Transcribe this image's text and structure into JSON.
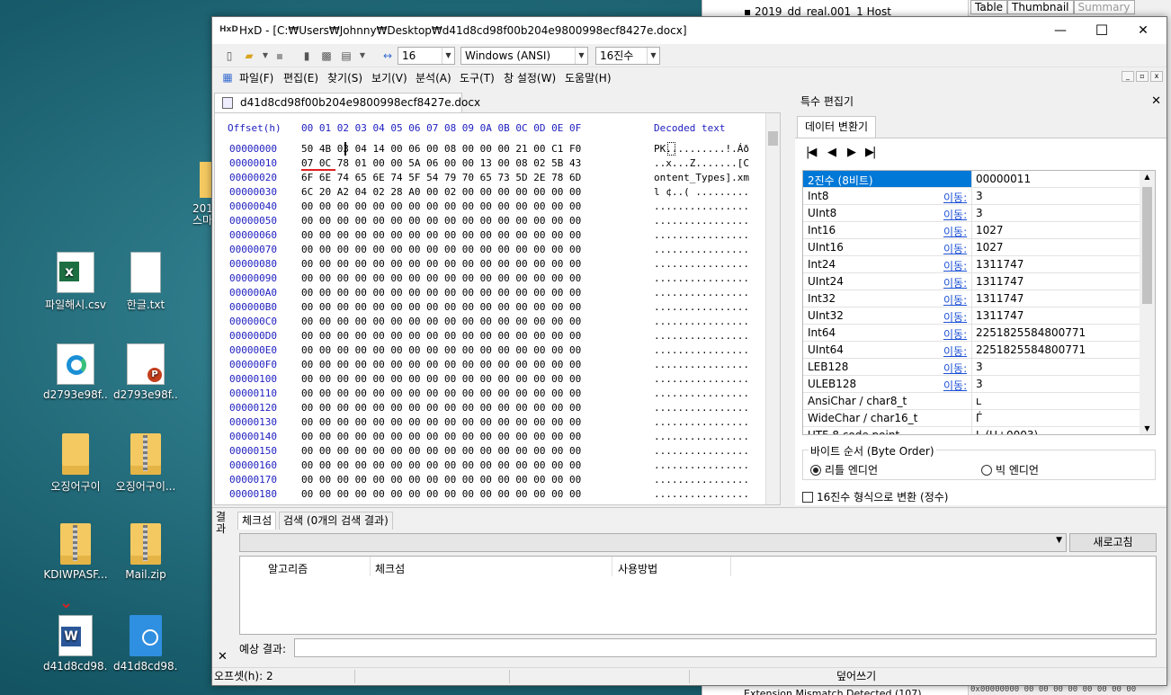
{
  "background_window": {
    "tree_item_top": "2019_dd_real.001_1 Host",
    "tree_item_bottom": "Extension Mismatch Detected (107)",
    "tabs": [
      "Table",
      "Thumbnail",
      "Summary"
    ],
    "bottom_hex": "0x00000000  00 00 00 00  00 00 00 00"
  },
  "desktop": {
    "icons": [
      {
        "label": "파일해시.csv"
      },
      {
        "label": "한글.txt"
      },
      {
        "label": "d2793e98f..."
      },
      {
        "label": "d2793e98f..."
      },
      {
        "label": "오징어구이"
      },
      {
        "label": "오징어구이..."
      },
      {
        "label": "KDIWPASF..."
      },
      {
        "label": "Mail.zip"
      },
      {
        "label": "d41d8cd98..."
      },
      {
        "label": "d41d8cd98..."
      }
    ],
    "partial_label": "201\n스마"
  },
  "window": {
    "title": "HxD - [C:₩Users₩Johnny₩Desktop₩d41d8cd98f00b204e9800998ecf8427e.docx]",
    "controls": {
      "minimize": "—",
      "maximize": "☐",
      "close": "✕"
    }
  },
  "toolbar": {
    "bytes_per_row": "16",
    "charset": "Windows (ANSI)",
    "offset_base": "16진수"
  },
  "menu": [
    "파일(F)",
    "편집(E)",
    "찾기(S)",
    "보기(V)",
    "분석(A)",
    "도구(T)",
    "창 설정(W)",
    "도움말(H)"
  ],
  "doc_tab": "d41d8cd98f00b204e9800998ecf8427e.docx",
  "hex_view": {
    "header_offset": "Offset(h)",
    "header_cols": "00 01 02 03 04 05 06 07 08 09 0A 0B 0C 0D 0E 0F",
    "header_decoded": "Decoded text",
    "offsets": [
      "00000000",
      "00000010",
      "00000020",
      "00000030",
      "00000040",
      "00000050",
      "00000060",
      "00000070",
      "00000080",
      "00000090",
      "000000A0",
      "000000B0",
      "000000C0",
      "000000D0",
      "000000E0",
      "000000F0",
      "00000100",
      "00000110",
      "00000120",
      "00000130",
      "00000140",
      "00000150",
      "00000160",
      "00000170",
      "00000180"
    ],
    "rows": [
      "50 4B 03 04 14 00 06 00 08 00 00 00 21 00 C1 F0",
      "07 0C 78 01 00 00 5A 06 00 00 13 00 08 02 5B 43",
      "6F 6E 74 65 6E 74 5F 54 79 70 65 73 5D 2E 78 6D",
      "6C 20 A2 04 02 28 A0 00 02 00 00 00 00 00 00 00",
      "00 00 00 00 00 00 00 00 00 00 00 00 00 00 00 00",
      "00 00 00 00 00 00 00 00 00 00 00 00 00 00 00 00",
      "00 00 00 00 00 00 00 00 00 00 00 00 00 00 00 00",
      "00 00 00 00 00 00 00 00 00 00 00 00 00 00 00 00",
      "00 00 00 00 00 00 00 00 00 00 00 00 00 00 00 00",
      "00 00 00 00 00 00 00 00 00 00 00 00 00 00 00 00",
      "00 00 00 00 00 00 00 00 00 00 00 00 00 00 00 00",
      "00 00 00 00 00 00 00 00 00 00 00 00 00 00 00 00",
      "00 00 00 00 00 00 00 00 00 00 00 00 00 00 00 00",
      "00 00 00 00 00 00 00 00 00 00 00 00 00 00 00 00",
      "00 00 00 00 00 00 00 00 00 00 00 00 00 00 00 00",
      "00 00 00 00 00 00 00 00 00 00 00 00 00 00 00 00",
      "00 00 00 00 00 00 00 00 00 00 00 00 00 00 00 00",
      "00 00 00 00 00 00 00 00 00 00 00 00 00 00 00 00",
      "00 00 00 00 00 00 00 00 00 00 00 00 00 00 00 00",
      "00 00 00 00 00 00 00 00 00 00 00 00 00 00 00 00",
      "00 00 00 00 00 00 00 00 00 00 00 00 00 00 00 00",
      "00 00 00 00 00 00 00 00 00 00 00 00 00 00 00 00",
      "00 00 00 00 00 00 00 00 00 00 00 00 00 00 00 00",
      "00 00 00 00 00 00 00 00 00 00 00 00 00 00 00 00",
      "00 00 00 00 00 00 00 00 00 00 00 00 00 00 00 00"
    ],
    "decoded": [
      "PK..........!.Áð",
      "..x...Z.......[C",
      "ontent_Types].xm",
      "l ¢..( .........",
      "................",
      "................",
      "................",
      "................",
      "................",
      "................",
      "................",
      "................",
      "................",
      "................",
      "................",
      "................",
      "................",
      "................",
      "................",
      "................",
      "................",
      "................",
      "................",
      "................",
      "................"
    ]
  },
  "special_editor": {
    "title": "특수 편집기",
    "tab": "데이터 변환기",
    "rows": [
      {
        "name": "2진수 (8비트)",
        "go": "",
        "value": "00000011"
      },
      {
        "name": "Int8",
        "go": "이동:",
        "value": "3"
      },
      {
        "name": "UInt8",
        "go": "이동:",
        "value": "3"
      },
      {
        "name": "Int16",
        "go": "이동:",
        "value": "1027"
      },
      {
        "name": "UInt16",
        "go": "이동:",
        "value": "1027"
      },
      {
        "name": "Int24",
        "go": "이동:",
        "value": "1311747"
      },
      {
        "name": "UInt24",
        "go": "이동:",
        "value": "1311747"
      },
      {
        "name": "Int32",
        "go": "이동:",
        "value": "1311747"
      },
      {
        "name": "UInt32",
        "go": "이동:",
        "value": "1311747"
      },
      {
        "name": "Int64",
        "go": "이동:",
        "value": "2251825584800771"
      },
      {
        "name": "UInt64",
        "go": "이동:",
        "value": "2251825584800771"
      },
      {
        "name": "LEB128",
        "go": "이동:",
        "value": "3"
      },
      {
        "name": "ULEB128",
        "go": "이동:",
        "value": "3"
      },
      {
        "name": "AnsiChar / char8_t",
        "go": "",
        "value": "ʟ"
      },
      {
        "name": "WideChar / char16_t",
        "go": "",
        "value": "Ѓ"
      },
      {
        "name": "UTF-8 code point",
        "go": "",
        "value": "L (U+0003)"
      }
    ],
    "byte_order_label": "바이트 순서 (Byte Order)",
    "little_endian": "리틀 엔디언",
    "big_endian": "빅 엔디언",
    "hex_format_checkbox": "16진수 형식으로 변환 (정수)"
  },
  "results": {
    "vertical_label": "결과",
    "tab_checksum": "체크섬",
    "tab_search": "검색 (0개의 검색 결과)",
    "refresh": "새로고침",
    "columns": [
      "알고리즘",
      "체크섬",
      "사용방법"
    ],
    "expected_label": "예상 결과:",
    "close": "✕"
  },
  "status": {
    "offset": "오프셋(h): 2",
    "mode": "덮어쓰기"
  }
}
